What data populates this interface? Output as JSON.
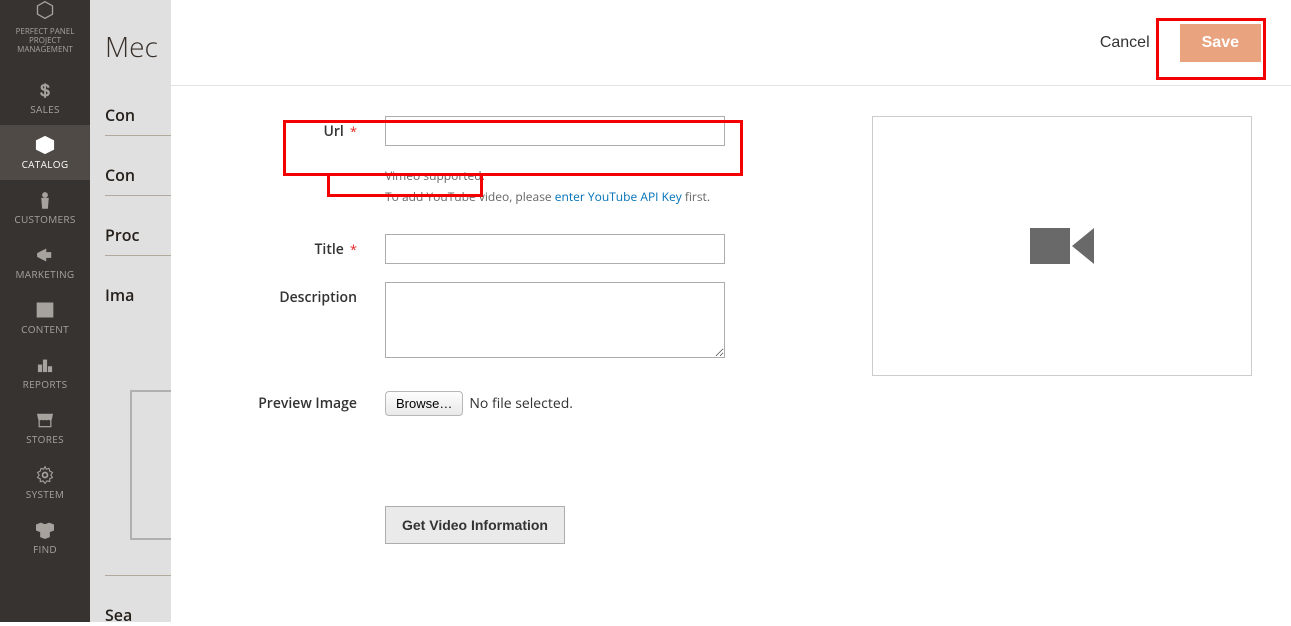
{
  "sidebar": {
    "top_label": "PERFECT PANEL PROJECT MANAGEMENT",
    "items": [
      {
        "label": "SALES"
      },
      {
        "label": "CATALOG"
      },
      {
        "label": "CUSTOMERS"
      },
      {
        "label": "MARKETING"
      },
      {
        "label": "CONTENT"
      },
      {
        "label": "REPORTS"
      },
      {
        "label": "STORES"
      },
      {
        "label": "SYSTEM"
      },
      {
        "label": "FIND"
      }
    ]
  },
  "page": {
    "title_partial": "Mec",
    "sections": [
      "Con",
      "Con",
      "Proc",
      "Ima",
      "Sea"
    ]
  },
  "modal": {
    "header": {
      "cancel": "Cancel",
      "save": "Save"
    },
    "fields": {
      "url": {
        "label": "Url",
        "value": ""
      },
      "url_hint_1": "Vimeo supported.",
      "url_hint_2a": "To add YouTube video, please ",
      "url_hint_link": "enter YouTube API Key",
      "url_hint_2b": " first.",
      "title": {
        "label": "Title",
        "value": ""
      },
      "description": {
        "label": "Description",
        "value": ""
      },
      "preview": {
        "label": "Preview Image",
        "browse": "Browse…",
        "nofile": "No file selected."
      },
      "info_btn": "Get Video Information"
    }
  }
}
